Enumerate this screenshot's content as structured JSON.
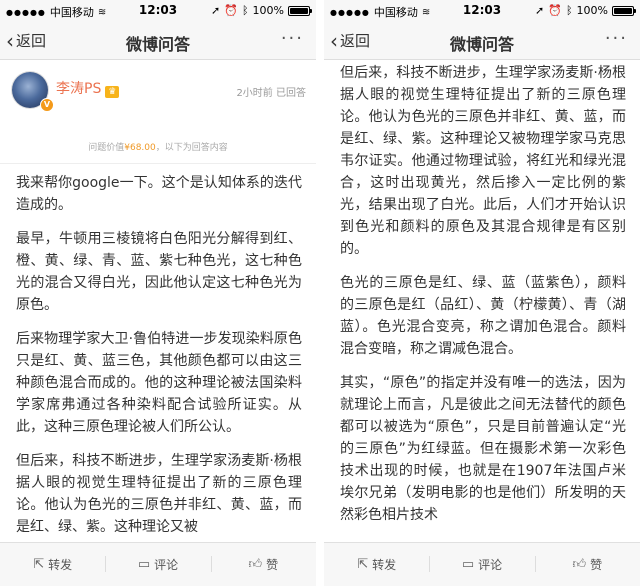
{
  "status": {
    "carrier": "中国移动",
    "time": "12:03",
    "battery": "100%",
    "battery_level": 1.0
  },
  "nav": {
    "back_label": "返回",
    "title": "微博问答",
    "more": "···"
  },
  "author": {
    "name": "李涛PS",
    "time_ago": "2小时前",
    "status": "已回答"
  },
  "price_line": {
    "prefix": "问题价值",
    "price": "¥68.00",
    "suffix": "，以下为回答内容"
  },
  "left_paragraphs": [
    "我来帮你google一下。这个是认知体系的迭代造成的。",
    "最早，牛顿用三棱镜将白色阳光分解得到红、橙、黄、绿、青、蓝、紫七种色光，这七种色光的混合又得白光，因此他认定这七种色光为原色。",
    "后来物理学家大卫·鲁伯特进一步发现染料原色只是红、黄、蓝三色，其他颜色都可以由这三种颜色混合而成的。他的这种理论被法国染料学家席弗通过各种染料配合试验所证实。从此，这种三原色理论被人们所公认。",
    "但后来，科技不断进步，生理学家汤麦斯·杨根据人眼的视觉生理特征提出了新的三原色理论。他认为色光的三原色并非红、黄、蓝，而是红、绿、紫。这种理论又被"
  ],
  "right_paragraphs": [
    "但后来，科技不断进步，生理学家汤麦斯·杨根据人眼的视觉生理特征提出了新的三原色理论。他认为色光的三原色并非红、黄、蓝，而是红、绿、紫。这种理论又被物理学家马克思韦尔证实。他通过物理试验，将红光和绿光混合，这时出现黄光，然后掺入一定比例的紫光，结果出现了白光。此后，人们才开始认识到色光和颜料的原色及其混合规律是有区别的。",
    "色光的三原色是红、绿、蓝（蓝紫色），颜料的三原色是红（品红）、黄（柠檬黄）、青（湖蓝）。色光混合变亮，称之谓加色混合。颜料混合变暗，称之谓减色混合。",
    "其实，“原色”的指定并没有唯一的选法，因为就理论上而言，凡是彼此之间无法替代的颜色都可以被选为“原色”，只是目前普遍认定“光的三原色”为红绿蓝。但在摄影术第一次彩色技术出现的时候，也就是在1907年法国卢米埃尔兄弟（发明电影的也是他们）所发明的天然彩色相片技术"
  ],
  "bottom": {
    "repost": "转发",
    "comment": "评论",
    "like": "赞",
    "repost_icon": "repost-icon",
    "comment_icon": "comment-icon",
    "like_icon": "thumbs-up-icon"
  },
  "colors": {
    "author_name": "#eb7350",
    "price": "#f09a28",
    "bar_bg": "#f7f7f7"
  }
}
